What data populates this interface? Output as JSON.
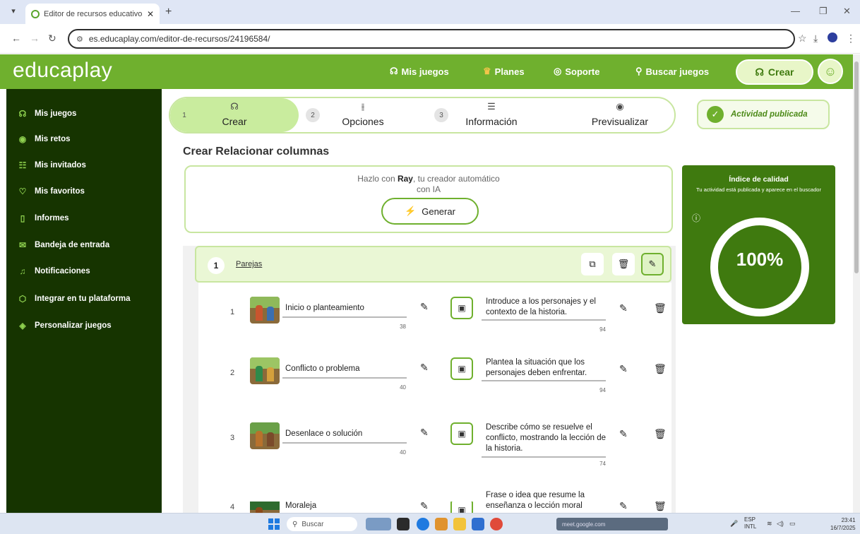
{
  "browser": {
    "tab_title": "Editor de recursos educativos",
    "url": "es.educaplay.com/editor-de-recursos/24196584/"
  },
  "header": {
    "logo": "educaplay",
    "nav": [
      "Mis juegos",
      "Planes",
      "Soporte",
      "Buscar juegos"
    ],
    "create_label": "Crear"
  },
  "sidebar": {
    "items": [
      {
        "label": "Mis juegos",
        "icon": "controller-icon"
      },
      {
        "label": "Mis retos",
        "icon": "target-icon"
      },
      {
        "label": "Mis invitados",
        "icon": "users-icon"
      },
      {
        "label": "Mis favoritos",
        "icon": "heart-icon"
      },
      {
        "label": "Informes",
        "icon": "clipboard-icon"
      },
      {
        "label": "Bandeja de entrada",
        "icon": "mail-icon"
      },
      {
        "label": "Notificaciones",
        "icon": "bell-icon"
      },
      {
        "label": "Integrar en tu plataforma",
        "icon": "cube-icon"
      },
      {
        "label": "Personalizar juegos",
        "icon": "paint-icon"
      }
    ]
  },
  "steps": [
    {
      "num": "1",
      "label": "Crear",
      "active": true
    },
    {
      "num": "2",
      "label": "Opciones",
      "active": false
    },
    {
      "num": "3",
      "label": "Información",
      "active": false
    },
    {
      "num": "",
      "label": "Previsualizar",
      "active": false
    }
  ],
  "status": {
    "published": "Actividad publicada"
  },
  "editor": {
    "title": "Crear Relacionar columnas",
    "ray_prefix": "Hazlo con ",
    "ray_name": "Ray",
    "ray_suffix": ", tu creador automático",
    "ray_line2": "con IA",
    "generate_label": "Generar"
  },
  "quality": {
    "title": "Índice de calidad",
    "subtitle": "Tu actividad está publicada y aparece en el buscador",
    "percent": "100%"
  },
  "pairs": {
    "num": "1",
    "title": "Parejas",
    "rows": [
      {
        "num": "1",
        "term": "Inicio o planteamiento",
        "term_count": "38",
        "definition": "Introduce a los personajes y el contexto de la historia.",
        "def_count": "94"
      },
      {
        "num": "2",
        "term": "Conflicto o problema",
        "term_count": "40",
        "definition": "Plantea la situación que los personajes deben enfrentar.",
        "def_count": "94"
      },
      {
        "num": "3",
        "term": "Desenlace o solución",
        "term_count": "40",
        "definition": "Describe cómo se resuelve el conflicto, mostrando la lección de la historia.",
        "def_count": "74"
      },
      {
        "num": "4",
        "term": "Moraleja",
        "term_count": "",
        "definition": "Frase o idea que resume la enseñanza o lección moral",
        "def_count": ""
      }
    ]
  },
  "taskbar": {
    "search": "Buscar",
    "active_tab": "meet.google.com",
    "lang": "ESP",
    "lang2": "INTL",
    "time": "23:41",
    "date": "16/7/2025"
  }
}
